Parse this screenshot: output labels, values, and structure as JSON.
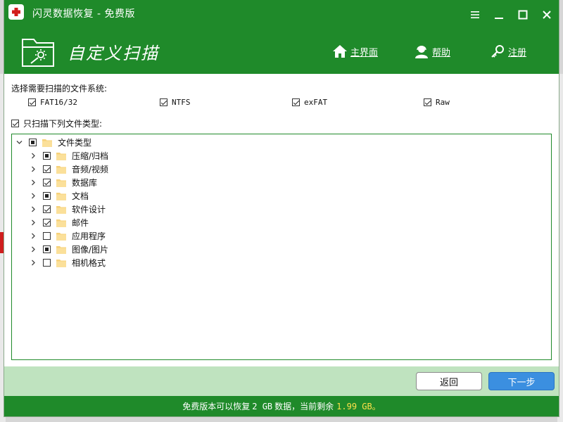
{
  "window": {
    "title": "闪灵数据恢复 - 免费版"
  },
  "header": {
    "title": "自定义扫描",
    "nav": {
      "home": "主界面",
      "help": "帮助",
      "register": "注册"
    }
  },
  "filesystems": {
    "label": "选择需要扫描的文件系统:",
    "items": [
      {
        "label": "FAT16/32",
        "checked": true
      },
      {
        "label": "NTFS",
        "checked": true
      },
      {
        "label": "exFAT",
        "checked": true
      },
      {
        "label": "Raw",
        "checked": true
      }
    ]
  },
  "only_types": {
    "label": "只扫描下列文件类型:",
    "checked": true
  },
  "tree": {
    "root": {
      "label": "文件类型",
      "state": "partial",
      "expanded": true
    },
    "children": [
      {
        "label": "压缩/归档",
        "state": "partial"
      },
      {
        "label": "音频/视频",
        "state": "checked"
      },
      {
        "label": "数据库",
        "state": "checked"
      },
      {
        "label": "文档",
        "state": "partial"
      },
      {
        "label": "软件设计",
        "state": "checked"
      },
      {
        "label": "邮件",
        "state": "checked"
      },
      {
        "label": "应用程序",
        "state": "unchecked"
      },
      {
        "label": "图像/图片",
        "state": "partial"
      },
      {
        "label": "相机格式",
        "state": "unchecked"
      }
    ]
  },
  "buttons": {
    "back": "返回",
    "next": "下一步"
  },
  "status": {
    "prefix": "免费版本可以恢复",
    "limit": "2 GB",
    "middle": "数据，当前剩余",
    "remaining": "1.99 GB。"
  },
  "colors": {
    "brand_green": "#1f8a2a",
    "footer_green": "#bfe3bf",
    "next_blue": "#3b8fe0",
    "highlight_yellow": "#ffe14a"
  }
}
